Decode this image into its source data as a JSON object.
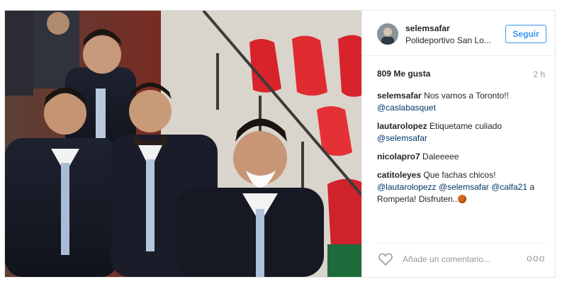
{
  "post": {
    "username": "selemsafar",
    "location": "Polideportivo San Lo...",
    "follow_label": "Seguir",
    "likes_text": "809 Me gusta",
    "age": "2 h",
    "comment_placeholder": "Añade un comentario...",
    "more_label": "ooo"
  },
  "comments": [
    {
      "user": "selemsafar",
      "text": "Nos vamos a Toronto!!",
      "mention1": "@caslabasquet"
    },
    {
      "user": "lautarolopez",
      "text": "Etiquetame culiado",
      "mention1": "@selemsafar"
    },
    {
      "user": "nicolapro7",
      "text": "Daleeeee"
    },
    {
      "user": "catitoleyes",
      "text": "Que fachas chicos!",
      "mention1": "@lautarolopezz",
      "mention2": "@selemsafar",
      "mention3": "@calfa21",
      "text2": "a Romperla! Disfruten.."
    }
  ],
  "icons": {
    "heart": "heart-icon",
    "basketball": "basketball-emoji-icon"
  },
  "colors": {
    "accent": "#3897f0",
    "mention": "#003569",
    "muted": "#999999"
  }
}
